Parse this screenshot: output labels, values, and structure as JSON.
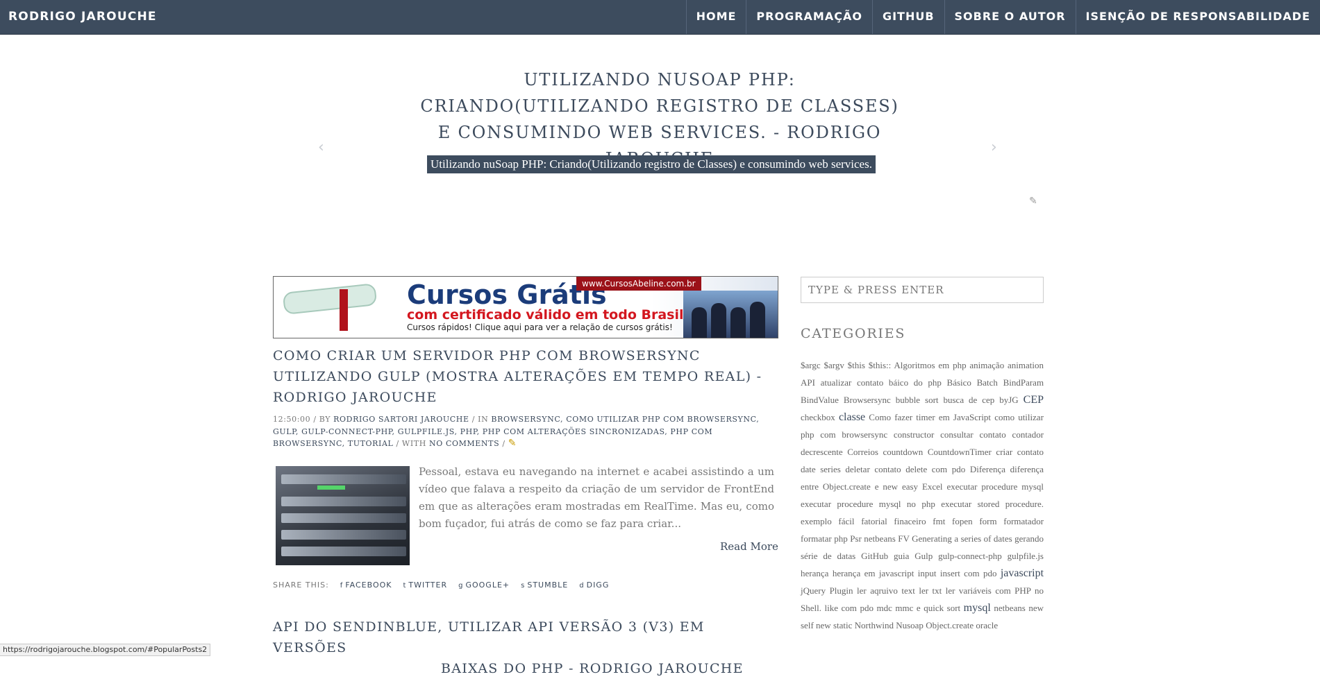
{
  "header": {
    "brand": "RODRIGO JAROUCHE",
    "nav": [
      "HOME",
      "PROGRAMAÇÃO",
      "GITHUB",
      "SOBRE O AUTOR",
      "ISENÇÃO DE RESPONSABILIDADE"
    ]
  },
  "hero": {
    "title": "UTILIZANDO NUSOAP PHP: CRIANDO(UTILIZANDO REGISTRO DE CLASSES) E CONSUMINDO WEB SERVICES. - RODRIGO JAROUCHE",
    "subtitle": "Utilizando  nuSoap PHP: Criando(Utilizando registro de Classes) e consumindo web services.",
    "prev_arrow": "‹",
    "next_arrow": "›"
  },
  "banner": {
    "title": "Cursos Grátis",
    "line2": "com certificado válido em todo Brasil",
    "line3": "Cursos rápidos! Clique aqui para ver a relação de cursos grátis!",
    "url": "www.CursosAbeline.com.br"
  },
  "post": {
    "title": "COMO CRIAR UM SERVIDOR PHP COM BROWSERSYNC UTILIZANDO GULP (MOSTRA ALTERAÇÕES EM TEMPO REAL) - RODRIGO JAROUCHE",
    "time": "12:50:00",
    "by_label": " / BY ",
    "author": "RODRIGO SARTORI JAROUCHE",
    "in_label": " / IN ",
    "labels": "BROWSERSYNC, COMO UTILIZAR PHP COM BROWSERSYNC, GULP, GULP-CONNECT-PHP, GULPFILE.JS, PHP, PHP COM ALTERAÇÕES SINCRONIZADAS, PHP COM BROWSERSYNC, TUTORIAL",
    "with_label": " / WITH ",
    "comments": "NO COMMENTS",
    "sep": " / ",
    "excerpt": "Pessoal, estava eu navegando na internet e acabei assistindo a um vídeo que falava a respeito da criação de um servidor de FrontEnd em que as alterações eram mostradas em RealTime. Mas eu, como bom fuçador, fui atrás de como se faz para criar...",
    "read_more": "Read More"
  },
  "share": {
    "label": "SHARE THIS:",
    "items": [
      "FACEBOOK",
      "TWITTER",
      "GOOGLE+",
      "STUMBLE",
      "DIGG"
    ],
    "icons": [
      "f",
      "t",
      "g",
      "s",
      "d"
    ]
  },
  "next_post": {
    "title_line1": "API DO SENDINBLUE, UTILIZAR API VERSÃO 3 (V3) EM VERSÕES",
    "title_line2": "BAIXAS DO PHP - RODRIGO JAROUCHE"
  },
  "sidebar": {
    "search_placeholder": "TYPE & PRESS ENTER",
    "categories_heading": "CATEGORIES",
    "tags": [
      "$argc",
      "$argv",
      "$this",
      "$this::",
      "Algoritmos em php",
      "animação",
      "animation",
      "API",
      "atualizar contato",
      "báico do php",
      "Básico",
      "Batch",
      "BindParam",
      "BindValue",
      "Browsersync",
      "bubble sort",
      "busca de cep",
      "byJG",
      "CEP",
      "checkbox",
      "classe",
      "Como fazer timer em JavaScript",
      "como utilizar php com browsersync",
      "constructor",
      "consultar contato",
      "contador",
      "decrescente",
      "Correios",
      "countdown",
      "CountdownTimer",
      "criar contato",
      "date series",
      "deletar contato",
      "delete com pdo",
      "Diferença",
      "diferença entre Object.create e new",
      "easy",
      "Excel",
      "executar procedure mysql",
      "executar procedure mysql no php",
      "executar stored procedure.",
      "exemplo fácil",
      "fatorial",
      "finaceiro",
      "fmt",
      "fopen",
      "form",
      "formatador",
      "formatar php",
      "Psr netbeans",
      "FV",
      "Generating a series of dates",
      "gerando série de datas",
      "GitHub",
      "guia",
      "Gulp",
      "gulp-connect-php",
      "gulpfile.js",
      "herança",
      "herança em javascript",
      "input",
      "insert com pdo",
      "javascript",
      "jQuery Plugin",
      "ler aqruivo text",
      "ler txt",
      "ler variáveis com PHP no Shell.",
      "like com pdo",
      "mdc",
      "mmc e quick sort",
      "mysql",
      "netbeans",
      "new",
      "self",
      "new static",
      "Northwind",
      "Nusoap",
      "Object.create",
      "oracle"
    ],
    "big_tags": [
      "CEP",
      "classe",
      "javascript",
      "mysql"
    ]
  },
  "status_bar": {
    "url": "https://rodrigojarouche.blogspot.com/#PopularPosts2"
  }
}
